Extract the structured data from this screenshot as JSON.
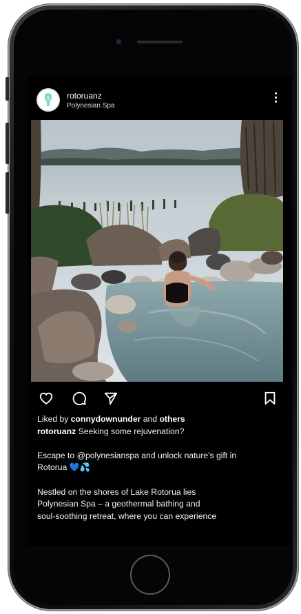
{
  "post": {
    "username": "rotoruanz",
    "location": "Polynesian Spa"
  },
  "likes": {
    "prefix": "Liked by ",
    "user": "connydownunder",
    "middle": " and ",
    "suffix": "others"
  },
  "caption": {
    "username": "rotoruanz",
    "line1": " Seeking some rejuvenation?",
    "para2_line1": "Escape to @polynesianspa and unlock nature's gift in",
    "para2_line2": "Rotorua",
    "para2_emoji": "💙💦",
    "para3_line1": "Nestled on the shores of Lake Rotorua lies",
    "para3_line2": "Polynesian Spa – a geothermal bathing and",
    "para3_line3": "soul-soothing retreat, where you can experience"
  },
  "icons": {
    "like": "heart-icon",
    "comment": "comment-icon",
    "share": "send-icon",
    "save": "bookmark-icon",
    "more": "more-options-icon"
  },
  "colors": {
    "screen_bg": "#000000",
    "text": "#ffffff",
    "heart_emoji": "#3b8ff0"
  }
}
